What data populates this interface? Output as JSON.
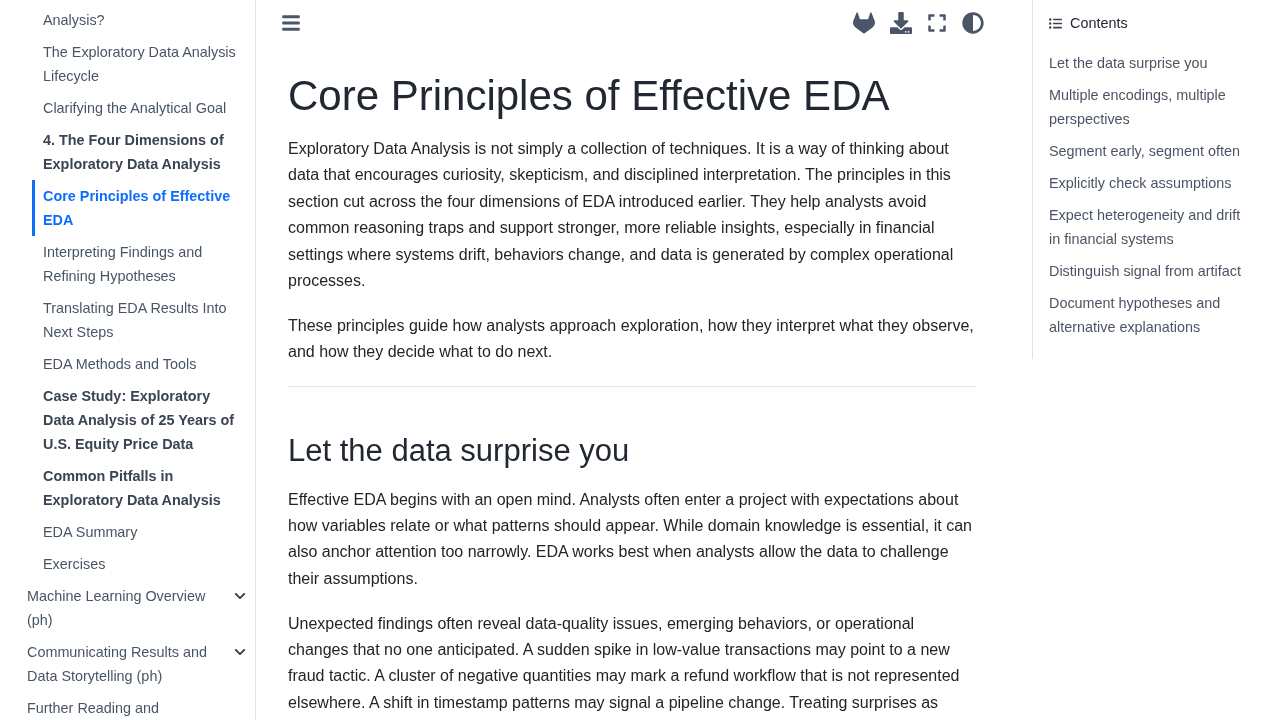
{
  "sidebar": {
    "subitems": [
      {
        "label": "Analysis?",
        "kind": "page",
        "selected": false
      },
      {
        "label": "The Exploratory Data Analysis Lifecycle",
        "kind": "page",
        "selected": false
      },
      {
        "label": "Clarifying the Analytical Goal",
        "kind": "page",
        "selected": false
      },
      {
        "label": "4. The Four Dimensions of Exploratory Data Analysis",
        "kind": "section",
        "selected": false
      },
      {
        "label": "Core Principles of Effective EDA",
        "kind": "page",
        "selected": true
      },
      {
        "label": "Interpreting Findings and Refining Hypotheses",
        "kind": "page",
        "selected": false
      },
      {
        "label": "Translating EDA Results Into Next Steps",
        "kind": "page",
        "selected": false
      },
      {
        "label": "EDA Methods and Tools",
        "kind": "page",
        "selected": false
      },
      {
        "label": "Case Study: Exploratory Data Analysis of 25 Years of U.S. Equity Price Data",
        "kind": "section",
        "selected": false
      },
      {
        "label": "Common Pitfalls in Exploratory Data Analysis",
        "kind": "section",
        "selected": false
      },
      {
        "label": "EDA Summary",
        "kind": "page",
        "selected": false
      },
      {
        "label": "Exercises",
        "kind": "page",
        "selected": false
      }
    ],
    "items": [
      {
        "label": "Machine Learning Overview (ph)",
        "kind": "group",
        "expanded": false
      },
      {
        "label": "Communicating Results and Data Storytelling (ph)",
        "kind": "group",
        "expanded": false
      },
      {
        "label": "Further Reading and",
        "kind": "link"
      }
    ]
  },
  "article": {
    "title": "Core Principles of Effective EDA",
    "intro": [
      "Exploratory Data Analysis is not simply a collection of techniques. It is a way of thinking about data that encourages curiosity, skepticism, and disciplined interpretation. The principles in this section cut across the four dimensions of EDA introduced earlier. They help analysts avoid common reasoning traps and support stronger, more reliable insights, especially in financial settings where systems drift, behaviors change, and data is generated by complex operational processes.",
      "These principles guide how analysts approach exploration, how they interpret what they observe, and how they decide what to do next."
    ],
    "sections": [
      {
        "heading": "Let the data surprise you",
        "paragraphs": [
          "Effective EDA begins with an open mind. Analysts often enter a project with expectations about how variables relate or what patterns should appear. While domain knowledge is essential, it can also anchor attention too narrowly. EDA works best when analysts allow the data to challenge their assumptions.",
          "Unexpected findings often reveal data-quality issues, emerging behaviors, or operational changes that no one anticipated. A sudden spike in low-value transactions may point to a new fraud tactic. A cluster of negative quantities may mark a refund workflow that is not represented elsewhere. A shift in timestamp patterns may signal a pipeline change. Treating surprises as"
        ]
      }
    ]
  },
  "toc": {
    "title": "Contents",
    "items": [
      "Let the data surprise you",
      "Multiple encodings, multiple perspectives",
      "Segment early, segment often",
      "Explicitly check assumptions",
      "Expect heterogeneity and drift in financial systems",
      "Distinguish signal from artifact",
      "Document hypotheses and alternative explanations"
    ]
  }
}
